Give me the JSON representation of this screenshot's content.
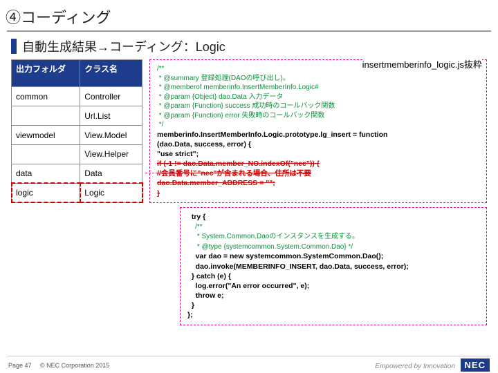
{
  "title": "④コーディング",
  "subtitle": "自動生成結果→コーディング：Logic",
  "table": {
    "headers": {
      "folder": "出力フォルダ",
      "class": "クラス名"
    },
    "rows": [
      {
        "folder": "common",
        "class": "Controller"
      },
      {
        "folder": "",
        "class": "Url.List"
      },
      {
        "folder": "viewmodel",
        "class": "View.Model"
      },
      {
        "folder": "",
        "class": "View.Helper"
      },
      {
        "folder": "data",
        "class": "Data"
      },
      {
        "folder": "logic",
        "class": "Logic"
      }
    ]
  },
  "codebox1": {
    "title": "insertmemberinfo_logic.js抜粋",
    "jsdoc": "/**\n * @summary 登録処理(DAOの呼び出し)。\n * @memberof memberinfo.InsertMemberInfo.Logic#\n * @param {Object} dao.Data 入力データ\n * @param {Function} success 成功時のコールバック関数\n * @param {Function} error 失敗時のコールバック関数\n */",
    "sig1": "memberinfo.InsertMemberInfo.Logic.prototype.lg_insert = function",
    "sig2": "(dao.Data, success, error) {",
    "sig3": "  \"use strict\";",
    "strike1": "  if (-1 != dao.Data.member_NO.indexOf(\"nec\")) {",
    "strike2": "    //会員番号に\"nec\"が含まれる場合、住所は不要",
    "strike3": "    dao.Data.member_ADDRESS = \"\";",
    "strike4": "  }"
  },
  "codebox2": {
    "pre": "  try {",
    "jsdoc": "    /**\n     * System.Common.Daoのインスタンスを生成する。\n     * @type {systemcommon.System.Common.Dao} */",
    "body": "    var dao = new systemcommon.SystemCommon.Dao();\n    dao.invoke(MEMBERINFO_INSERT, dao.Data, success, error);\n  } catch (e) {\n    log.error(\"An error occurred\", e);\n    throw e;\n  }\n};"
  },
  "footer": {
    "page": "Page 47",
    "copyright": "© NEC Corporation 2015",
    "tagline": "Empowered by Innovation",
    "logo": "NEC"
  }
}
